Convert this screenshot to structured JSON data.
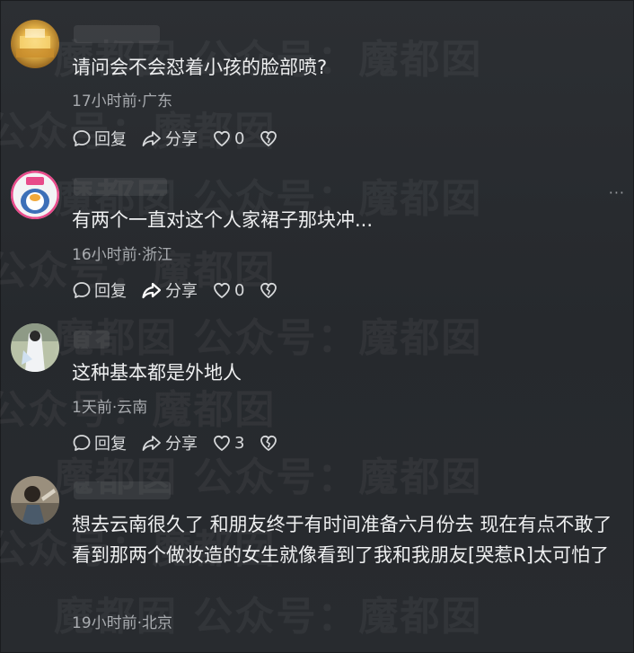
{
  "comments": [
    {
      "text": "请问会不会怼着小孩的脸部喷?",
      "meta": "17小时前·广东",
      "reply_label": "回复",
      "share_label": "分享",
      "likes": "0"
    },
    {
      "text": "有两个一直对这个人家裙子那块冲...",
      "meta": "16小时前·浙江",
      "reply_label": "回复",
      "share_label": "分享",
      "likes": "0"
    },
    {
      "text": "这种基本都是外地人",
      "meta": "1天前·云南",
      "reply_label": "回复",
      "share_label": "分享",
      "likes": "3"
    },
    {
      "text": "想去云南很久了 和朋友终于有时间准备六月份去 现在有点不敢了 看到那两个做妆造的女生就像看到了我和我朋友[哭惹R]太可怕了",
      "meta": "19小时前·北京"
    }
  ],
  "watermark": "魔都囡 公众号：魔都囡",
  "more_icon": "···",
  "colors": {
    "background": "#2a2d31",
    "text": "#eeeff0",
    "meta": "#a7aaae"
  }
}
